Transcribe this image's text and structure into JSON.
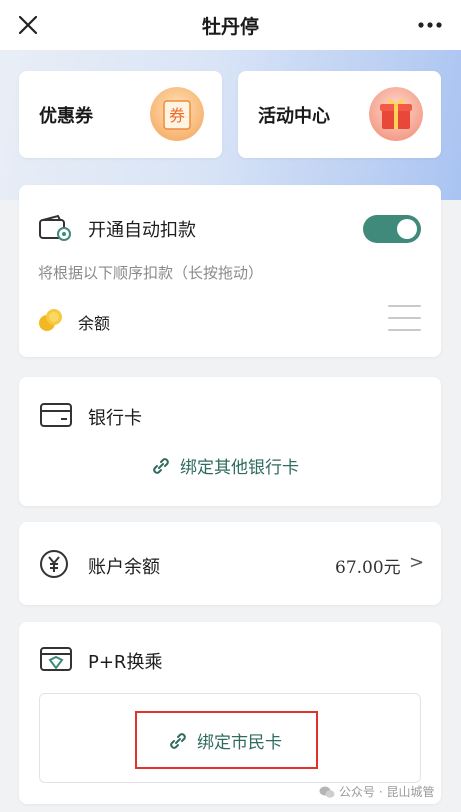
{
  "topbar": {
    "title": "牡丹停",
    "close_icon": "close-icon",
    "more_icon": "more-icon"
  },
  "promos": [
    {
      "label": "优惠券",
      "badge_text": "券",
      "icon": "coupon-icon"
    },
    {
      "label": "活动中心",
      "icon": "gift-icon"
    }
  ],
  "autopay": {
    "title": "开通自动扣款",
    "enabled": true,
    "hint": "将根据以下顺序扣款（长按拖动）",
    "items": [
      {
        "label": "余额",
        "icon": "coins-icon"
      }
    ]
  },
  "bank": {
    "title": "银行卡",
    "link": "绑定其他银行卡"
  },
  "balance": {
    "title": "账户余额",
    "amount": "67.00元",
    "chevron": ">"
  },
  "transfer": {
    "title": "P+R换乘",
    "link": "绑定市民卡"
  },
  "watermark": {
    "text": "公众号 · 昆山城管"
  },
  "colors": {
    "accent": "#3f8a7a",
    "link": "#2f6b5e",
    "highlight": "#e0332a"
  }
}
